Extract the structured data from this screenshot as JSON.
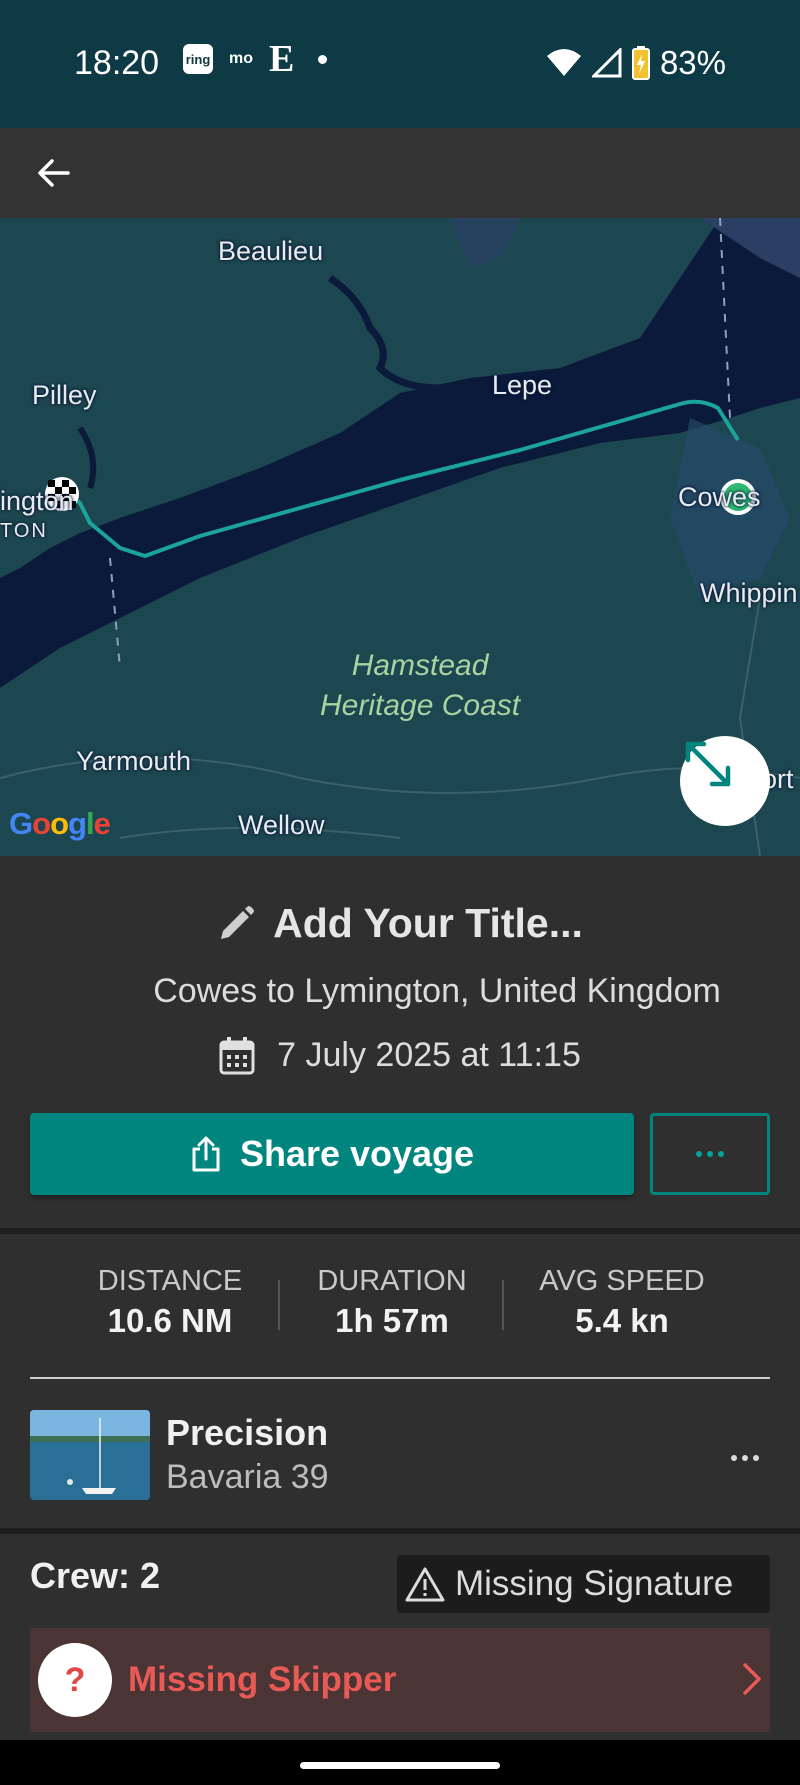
{
  "status_bar": {
    "time": "18:20",
    "ring_badge": "ring",
    "mo_badge": "mo",
    "e_badge": "E",
    "battery": "83%"
  },
  "toolbar": {
    "back_icon": "arrow-left-icon"
  },
  "map": {
    "labels": {
      "beaulieu": "Beaulieu",
      "pilley": "Pilley",
      "lepe": "Lepe",
      "lymington": "ington",
      "lymington_caps": "TON",
      "cowes": "Cowes",
      "whippingham": "Whippin",
      "hamstead_line1": "Hamstead",
      "hamstead_line2": "Heritage Coast",
      "yarmouth": "Yarmouth",
      "wellow": "Wellow",
      "east_cowes": "ort"
    },
    "attribution": "Google",
    "route_color": "#1ba39c",
    "start_marker_color": "#2eb872",
    "expand_icon": "expand-arrows-icon"
  },
  "voyage": {
    "title": "Add Your Title...",
    "route": "Cowes to Lymington, United Kingdom",
    "date": "7 July 2025 at 11:15"
  },
  "actions": {
    "share_label": "Share voyage",
    "share_icon": "share-icon",
    "more_icon": "more-horizontal-icon"
  },
  "stats": [
    {
      "label": "DISTANCE",
      "value": "10.6 NM"
    },
    {
      "label": "DURATION",
      "value": "1h 57m"
    },
    {
      "label": "AVG SPEED",
      "value": "5.4 kn"
    }
  ],
  "boat": {
    "name": "Precision",
    "model": "Bavaria 39"
  },
  "crew": {
    "label": "Crew: 2",
    "missing_signature": "Missing Signature",
    "missing_skipper": "Missing Skipper"
  },
  "colors": {
    "accent": "#00857f",
    "warning": "#e85a55",
    "status_bar": "#0d3a45"
  }
}
